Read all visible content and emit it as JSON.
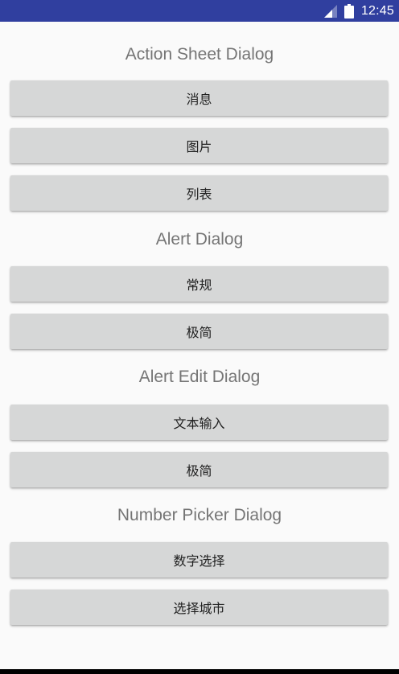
{
  "status_bar": {
    "time": "12:45",
    "icons": [
      "cell-signal-icon",
      "battery-icon"
    ],
    "background_color": "#303f9f"
  },
  "sections": {
    "action_sheet": {
      "title": "Action Sheet Dialog",
      "buttons": [
        "消息",
        "图片",
        "列表"
      ]
    },
    "alert": {
      "title": "Alert Dialog",
      "buttons": [
        "常规",
        "极简"
      ]
    },
    "alert_edit": {
      "title": "Alert Edit Dialog",
      "buttons": [
        "文本输入",
        "极简"
      ]
    },
    "number_picker": {
      "title": "Number Picker Dialog",
      "buttons": [
        "数字选择",
        "选择城市"
      ]
    }
  },
  "colors": {
    "background": "#fafafa",
    "button": "#d6d7d7",
    "section_title": "#757575",
    "button_text": "#212121"
  }
}
